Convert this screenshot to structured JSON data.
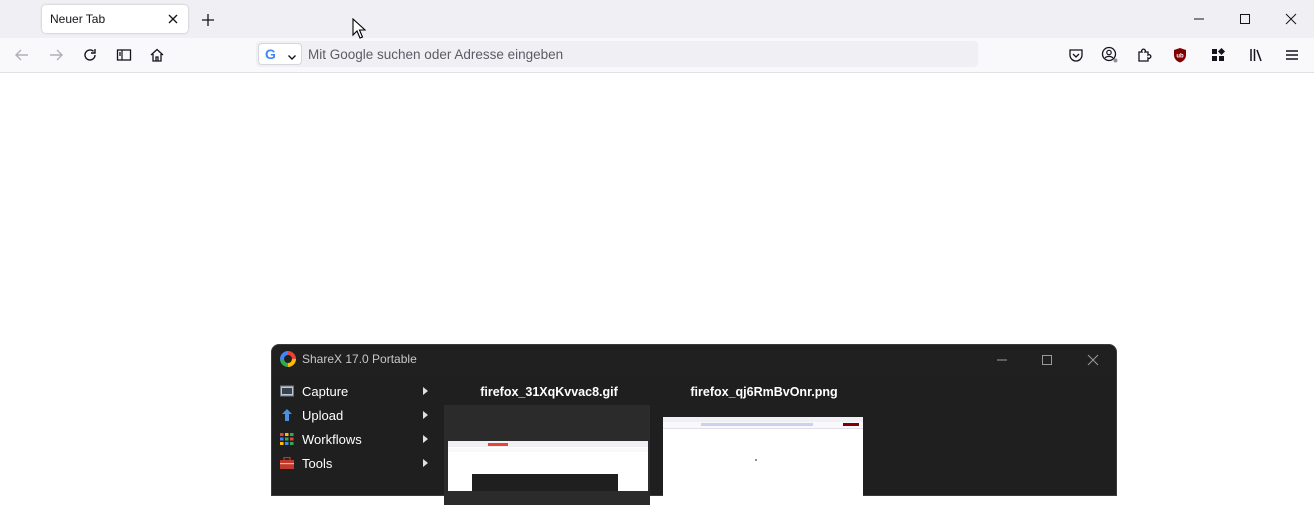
{
  "browser": {
    "tab": {
      "title": "Neuer Tab"
    },
    "urlbar": {
      "placeholder": "Mit Google suchen oder Adresse eingeben",
      "engine": "G"
    }
  },
  "sharex": {
    "title": "ShareX 17.0 Portable",
    "menu": [
      {
        "label": "Capture",
        "icon": "capture-icon"
      },
      {
        "label": "Upload",
        "icon": "upload-icon"
      },
      {
        "label": "Workflows",
        "icon": "workflows-icon"
      },
      {
        "label": "Tools",
        "icon": "tools-icon"
      }
    ],
    "files": [
      {
        "name": "firefox_31XqKvvac8.gif"
      },
      {
        "name": "firefox_qj6RmBvOnr.png"
      }
    ]
  }
}
